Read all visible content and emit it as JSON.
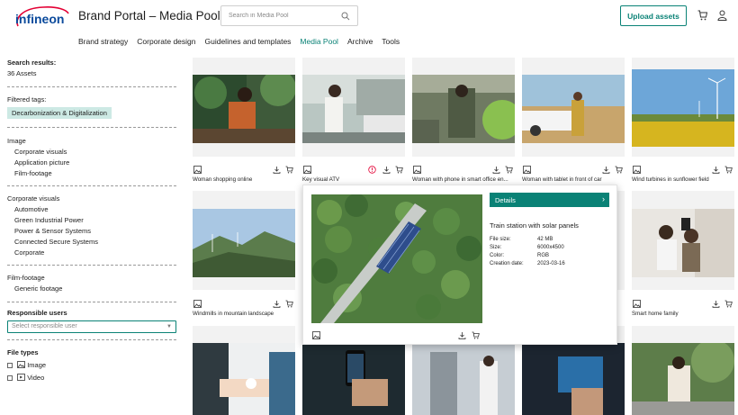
{
  "header": {
    "logo_text": "infineon",
    "title": "Brand Portal – Media Pool",
    "search_placeholder": "Search in Media Pool",
    "upload_label": "Upload assets"
  },
  "nav": {
    "items": [
      "Brand strategy",
      "Corporate design",
      "Guidelines and templates",
      "Media Pool",
      "Archive",
      "Tools"
    ],
    "active": "Media Pool"
  },
  "sidebar": {
    "search_results_label": "Search results:",
    "assets_count": "36 Assets",
    "filtered_tags_label": "Filtered tags:",
    "active_tag": "Decarbonization & Digitalization",
    "image_heading": "Image",
    "image_items": [
      "Corporate visuals",
      "Application picture",
      "Film-footage"
    ],
    "corporate_heading": "Corporate visuals",
    "corporate_items": [
      "Automotive",
      "Green Industrial Power",
      "Power & Sensor Systems",
      "Connected Secure Systems",
      "Corporate"
    ],
    "film_heading": "Film-footage",
    "film_items": [
      "Generic footage"
    ],
    "responsible_label": "Responsible users",
    "responsible_placeholder": "Select responsible user",
    "file_types_label": "File types",
    "file_types": [
      "Image",
      "Video"
    ]
  },
  "grid": {
    "row1_captions": [
      "Woman shopping online",
      "Key visual ATV",
      "Woman with phone in smart office en...",
      "Woman with tablet in front of car",
      "Wind turbines in sunflower field"
    ],
    "row2_captions": [
      "Windmills in mountain landscape",
      "Smart home family"
    ]
  },
  "overlay": {
    "details_label": "Details",
    "title": "Train station with solar panels",
    "meta": [
      {
        "k": "File size:",
        "v": "42 MB"
      },
      {
        "k": "Size:",
        "v": "6000x4500"
      },
      {
        "k": "Color:",
        "v": "RGB"
      },
      {
        "k": "Creation date:",
        "v": "2023-03-16"
      }
    ]
  },
  "colors": {
    "accent": "#0a8276",
    "tag_bg": "#cde9e4",
    "logo_red": "#e30034",
    "logo_blue": "#0a4a9c"
  }
}
